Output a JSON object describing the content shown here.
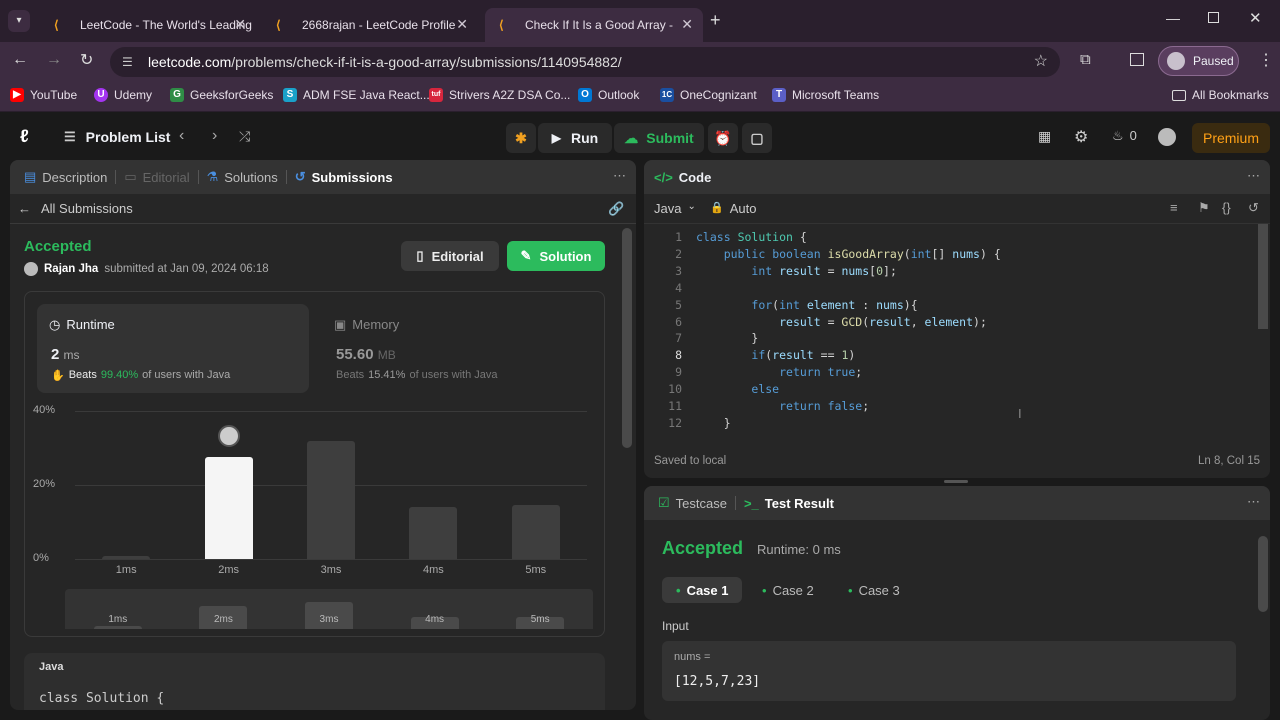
{
  "browser": {
    "tabs": [
      {
        "title": "LeetCode - The World's Leading"
      },
      {
        "title": "2668rajan - LeetCode Profile"
      },
      {
        "title": "Check If It Is a Good Array - Lee"
      }
    ],
    "url_host": "leetcode.com",
    "url_path": "/problems/check-if-it-is-a-good-array/submissions/1140954882/",
    "profile_label": "Paused",
    "bookmarks": [
      {
        "label": "YouTube",
        "color": "#ff0000"
      },
      {
        "label": "Udemy",
        "color": "#a435f0"
      },
      {
        "label": "GeeksforGeeks",
        "color": "#2f8d46"
      },
      {
        "label": "ADM FSE Java React...",
        "color": "#1aa1c9"
      },
      {
        "label": "Strivers A2Z DSA Co...",
        "color": "#d7263d"
      },
      {
        "label": "Outlook",
        "color": "#0078d4"
      },
      {
        "label": "OneCognizant",
        "color": "#1a4fa0"
      },
      {
        "label": "Microsoft Teams",
        "color": "#5b5fc7"
      }
    ],
    "all_bookmarks": "All Bookmarks"
  },
  "nav": {
    "problem_list": "Problem List",
    "run": "Run",
    "submit": "Submit",
    "fire_count": "0",
    "premium": "Premium"
  },
  "left": {
    "tabs": [
      "Description",
      "Editorial",
      "Solutions",
      "Submissions"
    ],
    "back": "All Submissions",
    "status": "Accepted",
    "user": "Rajan Jha",
    "submitted": "submitted at Jan 09, 2024 06:18",
    "editorial_btn": "Editorial",
    "solution_btn": "Solution",
    "runtime_label": "Runtime",
    "runtime_value": "2",
    "runtime_unit": "ms",
    "beats_label": "Beats",
    "runtime_beats": "99.40%",
    "users_java": "of users with Java",
    "memory_label": "Memory",
    "memory_value": "55.60",
    "memory_unit": "MB",
    "memory_beats": "15.41%",
    "lang": "Java",
    "code_preview": "class Solution {"
  },
  "chart_data": {
    "type": "bar",
    "categories": [
      "1ms",
      "2ms",
      "3ms",
      "4ms",
      "5ms"
    ],
    "values": [
      0.8,
      27.5,
      32,
      14,
      14.5
    ],
    "ylim": [
      0,
      40
    ],
    "yticks": [
      "40%",
      "20%",
      "0%"
    ],
    "highlight": "2ms",
    "bar_color": "#3e3e3e",
    "highlight_color": "#f5f5f5"
  },
  "code": {
    "title": "Code",
    "lang": "Java",
    "mode": "Auto",
    "saved": "Saved to local",
    "cursor": "Ln 8, Col 15",
    "lines": [
      "class Solution {",
      "    public boolean isGoodArray(int[] nums) {",
      "        int result = nums[0];",
      "",
      "        for(int element : nums){",
      "            result = GCD(result, element);",
      "        }",
      "        if(result == 1)",
      "            return true;",
      "        else",
      "            return false;",
      "    }"
    ]
  },
  "result": {
    "tab_testcase": "Testcase",
    "tab_result": "Test Result",
    "status": "Accepted",
    "runtime": "Runtime: 0 ms",
    "cases": [
      "Case 1",
      "Case 2",
      "Case 3"
    ],
    "input_label": "Input",
    "var_label": "nums =",
    "var_value": "[12,5,7,23]"
  }
}
